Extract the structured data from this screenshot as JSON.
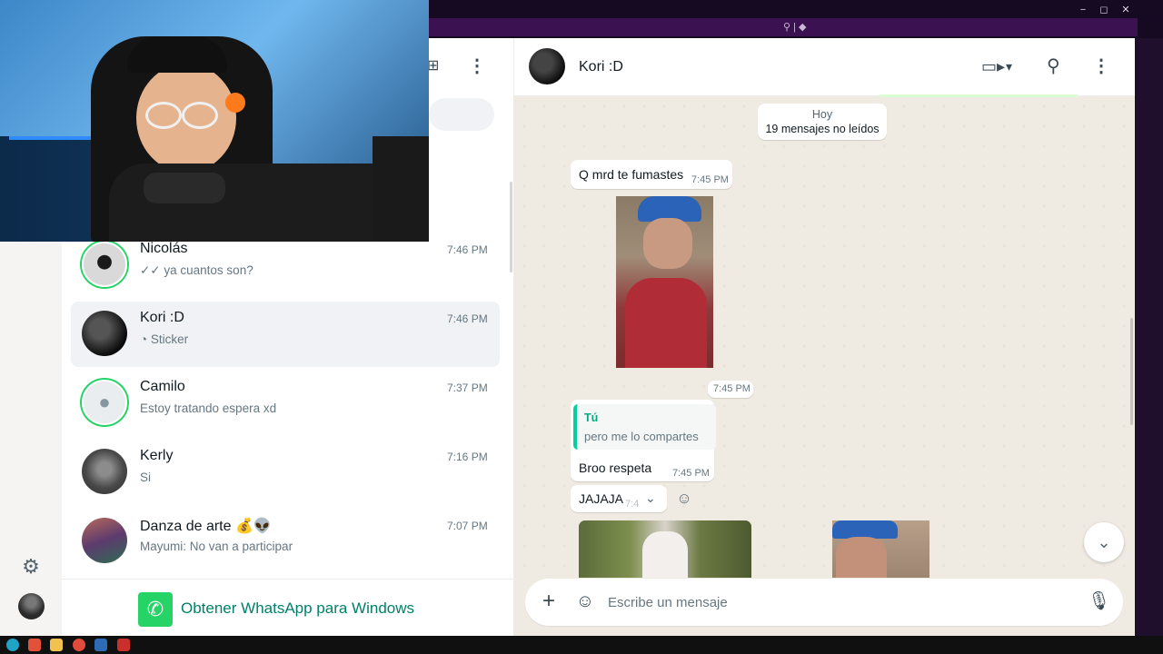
{
  "browser": {
    "controls": [
      "−",
      "◻",
      "✕"
    ],
    "bar_glyphs": "⚲ | ◆"
  },
  "sidebar": {
    "settings_icon": "gear-icon",
    "menu_glyph": "⋮",
    "newchat_glyph": "⊞"
  },
  "chats": [
    {
      "name": "Nicolás",
      "preview": "ya cuantos son?",
      "status_glyph": "✓✓",
      "time": "7:46 PM",
      "ring": true
    },
    {
      "name": "Kori :D",
      "preview": "Sticker",
      "status_glyph": "◔",
      "time": "7:46 PM",
      "ring": false
    },
    {
      "name": "Camilo",
      "preview": "Estoy tratando espera xd",
      "time": "7:37 PM",
      "ring": true
    },
    {
      "name": "Kerly",
      "preview": "Si",
      "time": "7:16 PM",
      "ring": false
    },
    {
      "name": "Danza de arte",
      "name_emojis": "💰👽",
      "preview": "Mayumi: No van a participar",
      "time": "7:07 PM",
      "ring": false
    }
  ],
  "promo": {
    "text": "Obtener WhatsApp para Windows"
  },
  "conversation": {
    "contact_name": "Kori :D",
    "date_chip": {
      "day": "Hoy",
      "unread": "19 mensajes no leídos"
    },
    "messages": [
      {
        "type": "text",
        "text": "Q mrd te fumastes",
        "time": "7:45 PM"
      },
      {
        "type": "image",
        "time": "7:45 PM"
      },
      {
        "type": "reply",
        "quote_author": "Tú",
        "quote_text": "pero me lo compartes",
        "text": "Broo respeta",
        "time": "7:45 PM"
      },
      {
        "type": "text",
        "text": "JAJAJA",
        "time": "7:4"
      }
    ]
  },
  "composer": {
    "placeholder": "Escribe un mensaje"
  },
  "colors": {
    "accent": "#25d366",
    "link_green": "#008069",
    "chat_bg": "#efeae2",
    "quote_bar": "#06cf9c"
  }
}
